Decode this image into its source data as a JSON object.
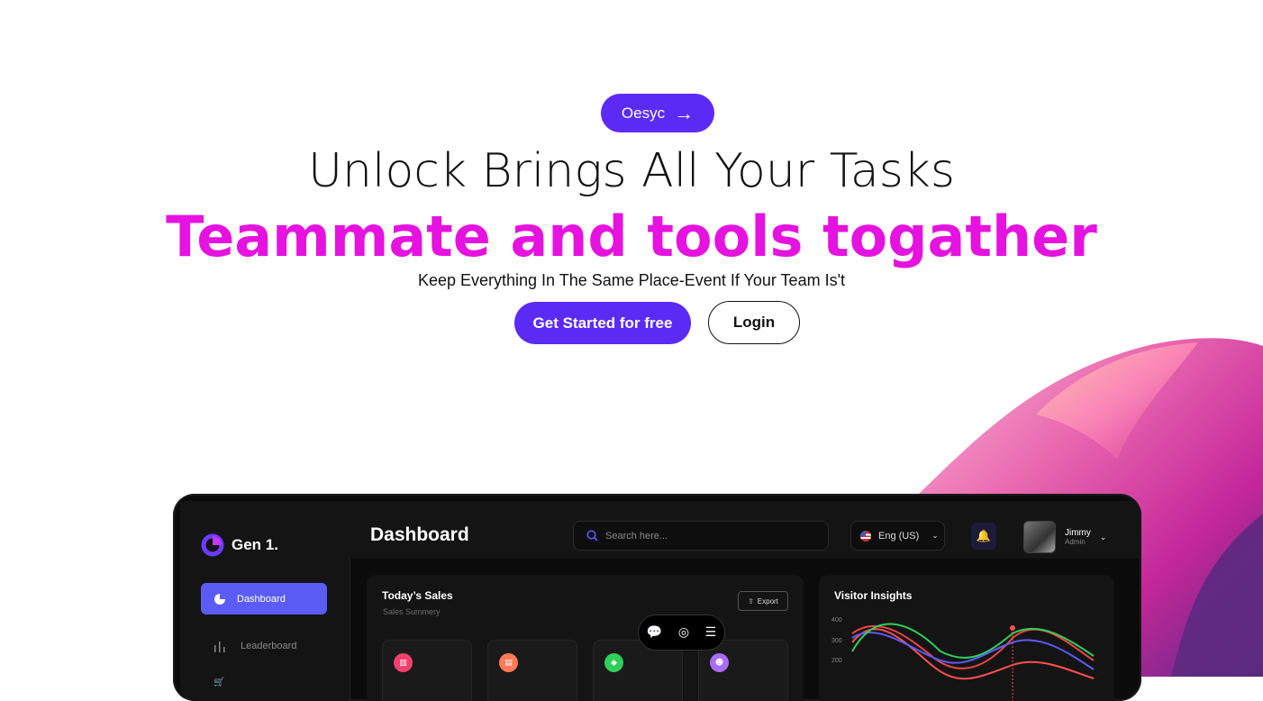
{
  "hero": {
    "badge_label": "Oesyc",
    "headline": "Unlock Brings All Your Tasks",
    "highlight": "Teammate and tools togather",
    "subheadline": "Keep Everything In The Same Place-Event If Your Team Is't",
    "primary_cta": "Get Started for free",
    "secondary_cta": "Login"
  },
  "colors": {
    "brand": "#5b2bf5",
    "highlight": "#e512e0"
  },
  "dashboard": {
    "logo": "Gen 1.",
    "nav": [
      "Dashboard",
      "Leaderboard"
    ],
    "title": "Dashboard",
    "search_placeholder": "Search here...",
    "language": "Eng (US)",
    "user": {
      "name": "Jimmy",
      "role": "Admin"
    },
    "sales_card": {
      "title": "Today’s Sales",
      "subtitle": "Sales Summery",
      "export": "Export"
    },
    "visitor_card": {
      "title": "Visitor Insights"
    },
    "chart_labels": [
      "400",
      "300",
      "200"
    ]
  }
}
